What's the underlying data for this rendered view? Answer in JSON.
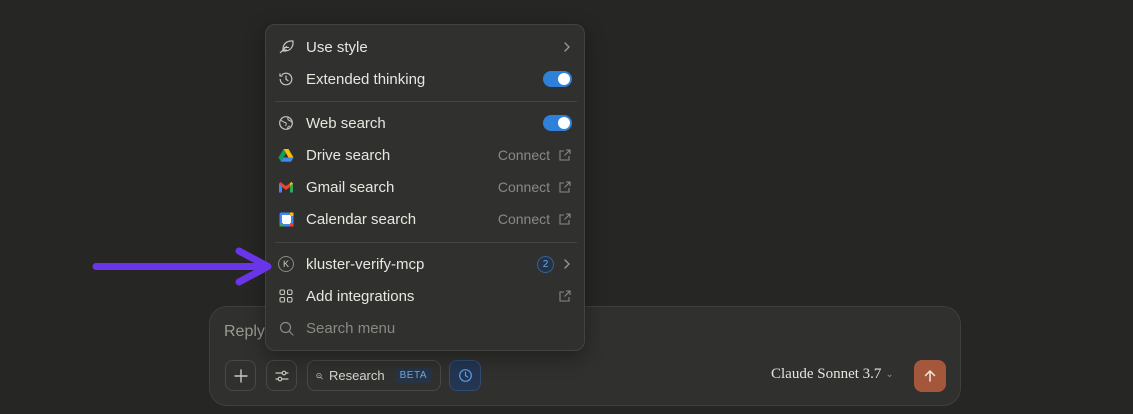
{
  "composer": {
    "placeholder": "Reply",
    "research_label": "Research",
    "research_badge": "BETA",
    "model_name": "Claude Sonnet 3.7"
  },
  "menu": {
    "use_style": "Use style",
    "extended_thinking": "Extended thinking",
    "web_search": "Web search",
    "drive_search": "Drive search",
    "gmail_search": "Gmail search",
    "calendar_search": "Calendar search",
    "connect": "Connect",
    "mcp_server": "kluster-verify-mcp",
    "mcp_count": "2",
    "mcp_icon_letter": "K",
    "add_integrations": "Add integrations",
    "search_menu": "Search menu"
  },
  "toggles": {
    "extended_thinking": true,
    "web_search": true
  },
  "colors": {
    "accent_blue": "#2f80d9",
    "send_button": "#a5573c",
    "annotation_arrow": "#6a35e8"
  },
  "icons": {
    "use_style": "feather-icon",
    "extended_thinking": "clock-icon",
    "web_search": "globe-icon",
    "drive_search": "google-drive-icon",
    "gmail_search": "gmail-icon",
    "calendar_search": "google-calendar-icon",
    "external": "external-link-icon",
    "add_integrations": "grid-icon",
    "search": "search-icon"
  }
}
